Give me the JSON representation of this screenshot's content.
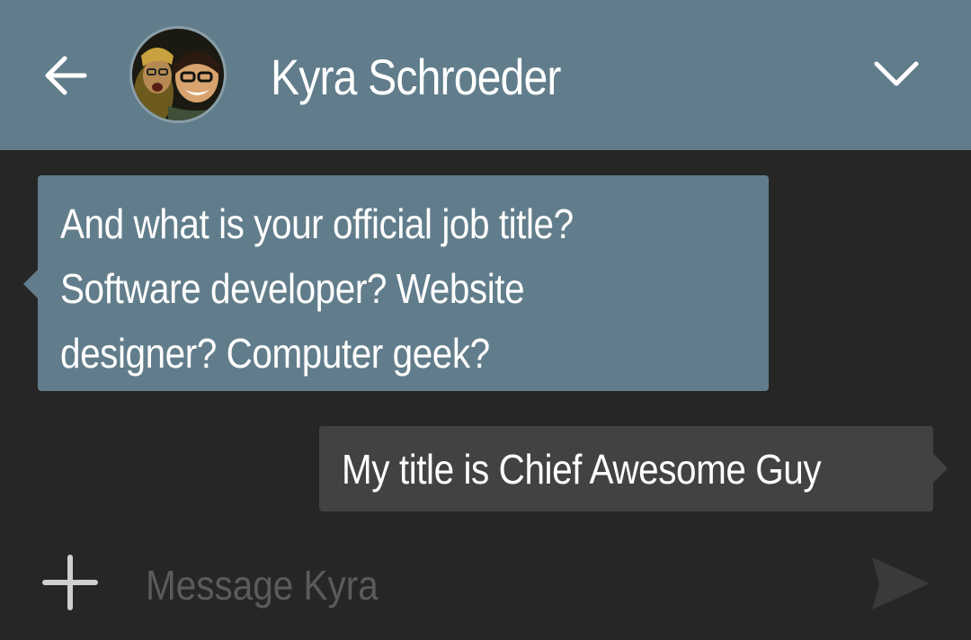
{
  "header": {
    "contact_name": "Kyra Schroeder",
    "background_color": "#617d8b",
    "back_icon": "arrow-left-icon",
    "menu_icon": "chevron-down-icon",
    "avatar": "contact-avatar-photo"
  },
  "messages": [
    {
      "direction": "incoming",
      "lines": [
        "And what is your official job title?",
        "Software developer? Website",
        "designer? Computer geek?"
      ],
      "color": "#617d8b"
    },
    {
      "direction": "outgoing",
      "lines": [
        "My title is Chief Awesome Guy"
      ],
      "color": "#424242"
    }
  ],
  "composer": {
    "placeholder": "Message Kyra",
    "value": "",
    "add_icon": "plus-icon",
    "send_icon": "send-icon"
  }
}
